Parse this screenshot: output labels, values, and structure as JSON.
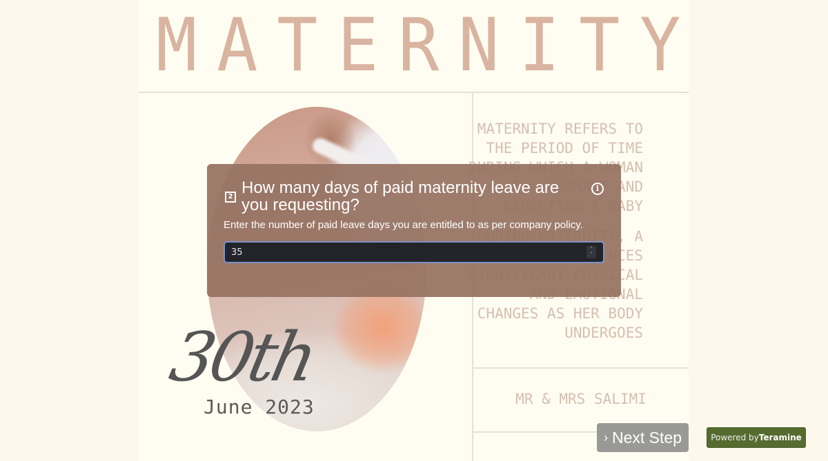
{
  "poster": {
    "title_letters": [
      "M",
      "A",
      "T",
      "E",
      "R",
      "N",
      "I",
      "T",
      "Y"
    ],
    "about_paragraph_1": "MATERNITY REFERS TO\nTHE PERIOD OF TIME\nDURING WHICH A WOMAN\nIS PREGNANT AND\nEXPECTING A BABY",
    "about_paragraph_2": "DURING MATERNITY, A\nWOMAN EXPERIENCES\nSIGNIFICANT PHYSICAL\nAND EMOTIONAL\nCHANGES AS HER BODY\nUNDERGOES",
    "date_day": "30th",
    "date_month_year": "June 2023",
    "names": "MR & MRS SALIMI"
  },
  "question": {
    "number": "2",
    "text": "How many days of paid maternity leave are you requesting?",
    "description": "Enter the number of paid leave days you are entitled to as per company policy.",
    "input_value": "35",
    "info_icon": "info-icon",
    "spinner_up": "˄",
    "spinner_down": "˅"
  },
  "footer": {
    "next_label": "Next Step",
    "next_chevron": "›",
    "powered_prefix": "Powered by",
    "powered_brand": "Teramine"
  },
  "colors": {
    "page_bg": "#fcf9ec",
    "poster_bg": "#fffdf1",
    "title": "#d9b4a0",
    "body_text": "#d6bfb1",
    "modal_bg": "#967262",
    "input_bg": "#22242a",
    "input_border": "#7d93c9",
    "next_button": "#999a97",
    "powered_badge": "#556b2f"
  }
}
